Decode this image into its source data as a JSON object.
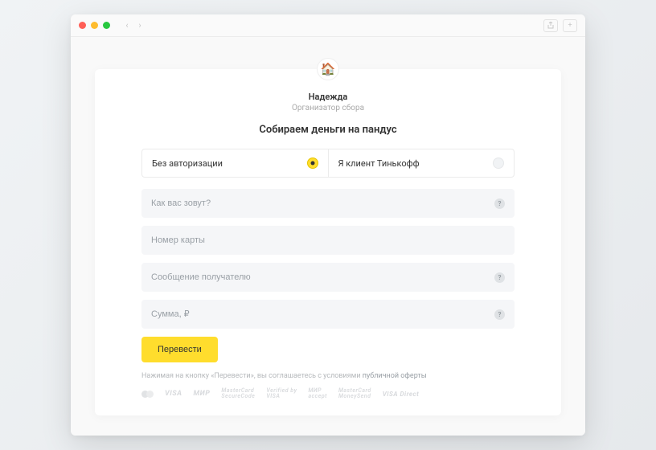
{
  "organizer": {
    "avatar_emoji": "🏠",
    "name": "Надежда",
    "role": "Организатор сбора"
  },
  "heading": "Собираем деньги на пандус",
  "auth_tabs": {
    "no_auth": "Без авторизации",
    "client": "Я клиент Тинькофф"
  },
  "fields": {
    "name_placeholder": "Как вас зовут?",
    "card_placeholder": "Номер карты",
    "message_placeholder": "Сообщение получателю",
    "amount_placeholder": "Сумма, ₽"
  },
  "submit_label": "Перевести",
  "disclaimer": {
    "prefix": "Нажимая на кнопку «Перевести», вы соглашаетесь с условиями ",
    "link": "публичной оферты"
  },
  "payment_logos": [
    "mastercard",
    "VISA",
    "МИР",
    "MasterCard SecureCode",
    "Verified by VISA",
    "МИР accept",
    "MasterCard MoneySend",
    "VISA Direct"
  ]
}
